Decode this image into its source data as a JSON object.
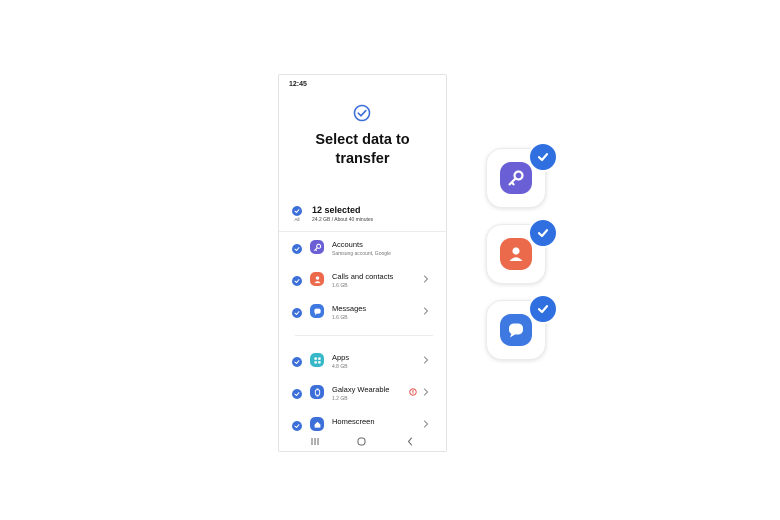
{
  "status_bar": {
    "time": "12:45"
  },
  "header": {
    "title_line1": "Select data to",
    "title_line2": "transfer"
  },
  "summary": {
    "all_label": "All",
    "selected": "12 selected",
    "details": "24.2 GB / About 40 minutes"
  },
  "items": [
    {
      "name": "Accounts",
      "sub": "Samsung account, Google",
      "icon": "key-icon",
      "color": "#6b5fd6",
      "chevron": false,
      "warning": false
    },
    {
      "name": "Calls and contacts",
      "sub": "1.6 GB",
      "icon": "contact-icon",
      "color": "#ec6a4c",
      "chevron": true,
      "warning": false
    },
    {
      "name": "Messages",
      "sub": "1.6 GB",
      "icon": "message-icon",
      "color": "#3d79e0",
      "chevron": true,
      "warning": false
    },
    {
      "name": "Apps",
      "sub": "4.8 GB",
      "icon": "apps-grid-icon",
      "color": "#37b8c8",
      "chevron": true,
      "warning": false
    },
    {
      "name": "Galaxy Wearable",
      "sub": "1.2 GB",
      "icon": "wearable-icon",
      "color": "#3d6fd9",
      "chevron": true,
      "warning": true
    },
    {
      "name": "Homescreen",
      "sub": "",
      "icon": "home-icon",
      "color": "#3d6fd9",
      "chevron": true,
      "warning": false
    }
  ],
  "colors": {
    "accent": "#3d6fd9",
    "badge": "#2f6fe0",
    "warning": "#e0413a"
  },
  "side_tiles": [
    {
      "icon": "key-icon",
      "color": "#6b5fd6",
      "checked": true
    },
    {
      "icon": "contact-icon",
      "color": "#ec6a4c",
      "checked": true
    },
    {
      "icon": "message-icon",
      "color": "#3d79e0",
      "checked": true
    }
  ]
}
